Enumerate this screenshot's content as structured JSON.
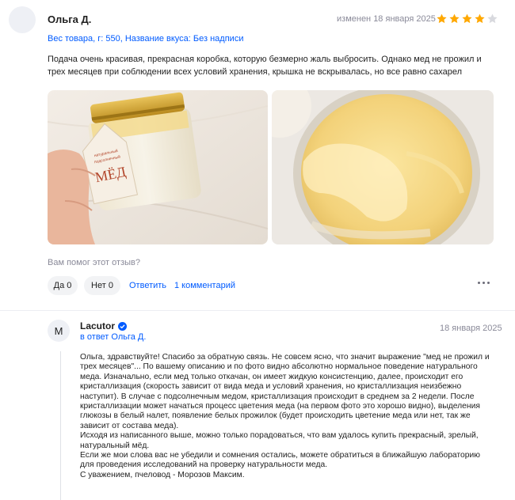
{
  "review": {
    "author": "Ольга Д.",
    "edited": "изменен 18 января 2025",
    "rating": 4,
    "rating_max": 5,
    "properties": "Вес товара, г: 550, Название вкуса: Без надписи",
    "text": "Подача очень красивая, прекрасная коробка, которую безмерно жаль выбросить. Однако мед не прожил и трех месяцев при соблюдении всех условий хранения, крышка не вскрывалась, но все равно сахарел",
    "photo1_label": "натуральный подсолнечный МЁД",
    "helpful_question": "Вам помог этот отзыв?",
    "yes_label": "Да 0",
    "no_label": "Нет 0",
    "reply_label": "Ответить",
    "comments_label": "1 комментарий"
  },
  "reply": {
    "avatar_letter": "M",
    "author": "Lacutor",
    "date": "18 января 2025",
    "in_reply_to": "в ответ Ольга Д.",
    "paragraphs": [
      "Ольга, здравствуйте! Спасибо за обратную связь. Не совсем ясно, что значит выражение \"мед не прожил и трех месяцев\"... По вашему описанию и по фото видно абсолютно нормальное поведение натурального меда. Изначально, если мед только откачан, он имеет жидкую консистенцию, далее, происходит его кристаллизация (скорость зависит от вида меда и условий хранения, но кристаллизация неизбежно наступит). В случае с подсолнечным медом, кристаллизация происходит в среднем за 2 недели. После кристаллизации может начаться процесс цветения меда (на первом фото это хорошо видно), выделения глюкозы в белый налет, появление белых прожилок (будет происходить цветение меда или нет, так же зависит от состава меда).",
      "Исходя из написанного выше, можно только порадоваться, что вам удалось купить прекрасный, зрелый, натуральный мёд.",
      "Если же мои слова вас не убедили и сомнения остались, можете обратиться в ближайшую лабораторию для проведения исследований на проверку натуральности меда.",
      "С уважением, пчеловод - Морозов Максим."
    ]
  },
  "colors": {
    "link": "#005bff",
    "star_on": "#ffa800",
    "star_off": "#d8d9de",
    "verified": "#005bff"
  }
}
